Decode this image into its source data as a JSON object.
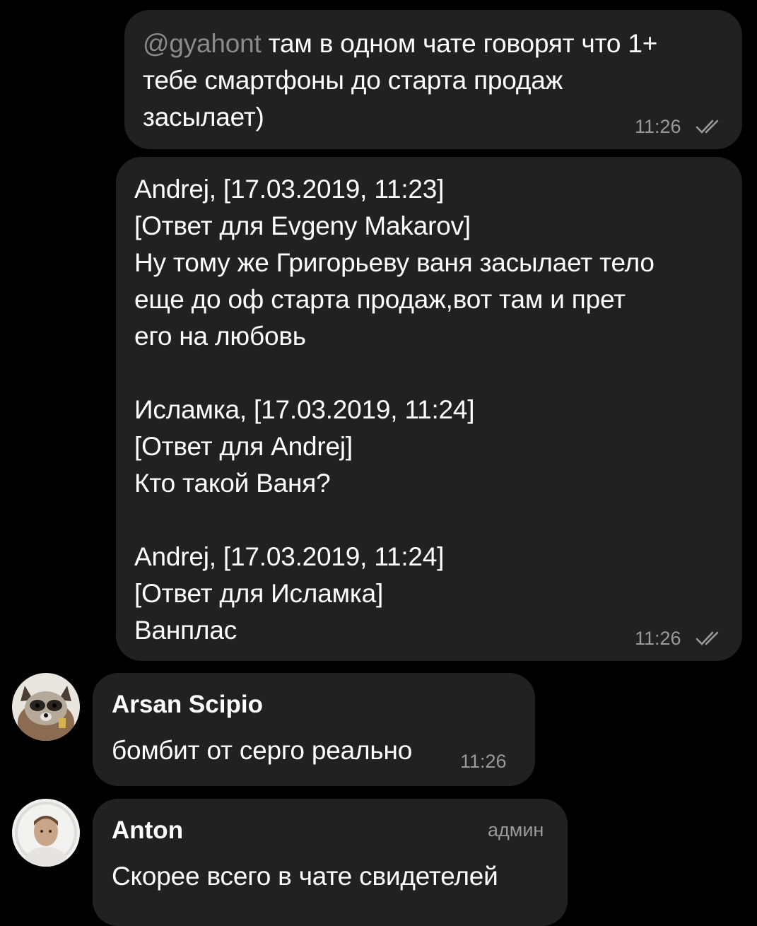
{
  "messages": [
    {
      "mention": "@gyahont",
      "line1": " там в одном чате говорят что 1+",
      "line2": "тебе смартфоны до старта продаж",
      "line3": "засылает)",
      "time": "11:26",
      "read_icon": "double-check-icon"
    },
    {
      "lines": [
        "Andrej, [17.03.2019, 11:23]",
        "[Ответ для Evgeny Makarov]",
        "Ну тому же Григорьеву ваня засылает тело",
        "еще до оф старта продаж,вот там и прет",
        "его на любовь",
        "",
        "Исламка, [17.03.2019, 11:24]",
        "[Ответ для Andrej]",
        "Кто такой Ваня?",
        "",
        "Andrej, [17.03.2019, 11:24]",
        "[Ответ для Исламка]",
        "Ванплас"
      ],
      "time": "11:26",
      "read_icon": "double-check-icon"
    },
    {
      "sender": "Arsan Scipio",
      "text": "бомбит от серго реально",
      "time": "11:26",
      "avatar_icon": "raccoon-avatar"
    },
    {
      "sender": "Anton",
      "role": "админ",
      "text": "Скорее всего в чате свидетелей",
      "avatar_icon": "person-avatar"
    }
  ],
  "colors": {
    "background": "#000000",
    "bubble": "#212121",
    "text": "#ffffff",
    "meta": "#9a9a9a",
    "mention": "#8a8a8a"
  }
}
